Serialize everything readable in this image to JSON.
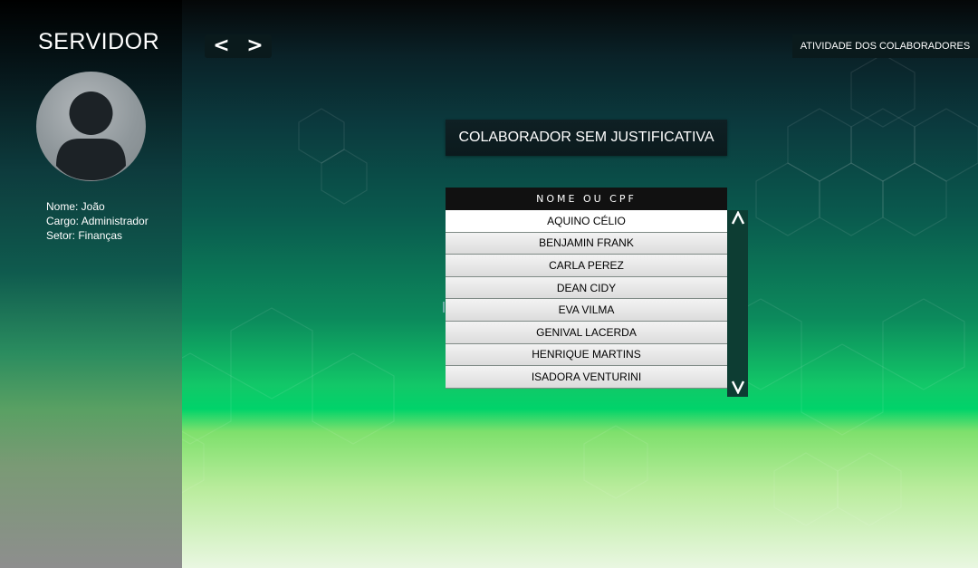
{
  "app": {
    "title": "SERVIDOR"
  },
  "user": {
    "name": "Nome: João",
    "role": "Cargo: Administrador",
    "sector": "Setor: Finanças"
  },
  "nav": {
    "back": "<",
    "forward": ">"
  },
  "header_link": {
    "label": "ATIVIDADE DOS COLABORADORES"
  },
  "section": {
    "title": "COLABORADOR SEM JUSTIFICATIVA"
  },
  "list": {
    "header": "NOME OU CPF",
    "items": [
      "AQUINO CÉLIO",
      "BENJAMIN FRANK",
      "CARLA PEREZ",
      "DEAN CIDY",
      "EVA VILMA",
      "GENIVAL LACERDA",
      "HENRIQUE MARTINS",
      "ISADORA VENTURINI"
    ],
    "scroll_up": "^",
    "scroll_down": "v"
  },
  "icons": {
    "avatar": "user-avatar-icon",
    "scroll_up": "chevron-up-icon",
    "scroll_down": "chevron-down-icon"
  }
}
